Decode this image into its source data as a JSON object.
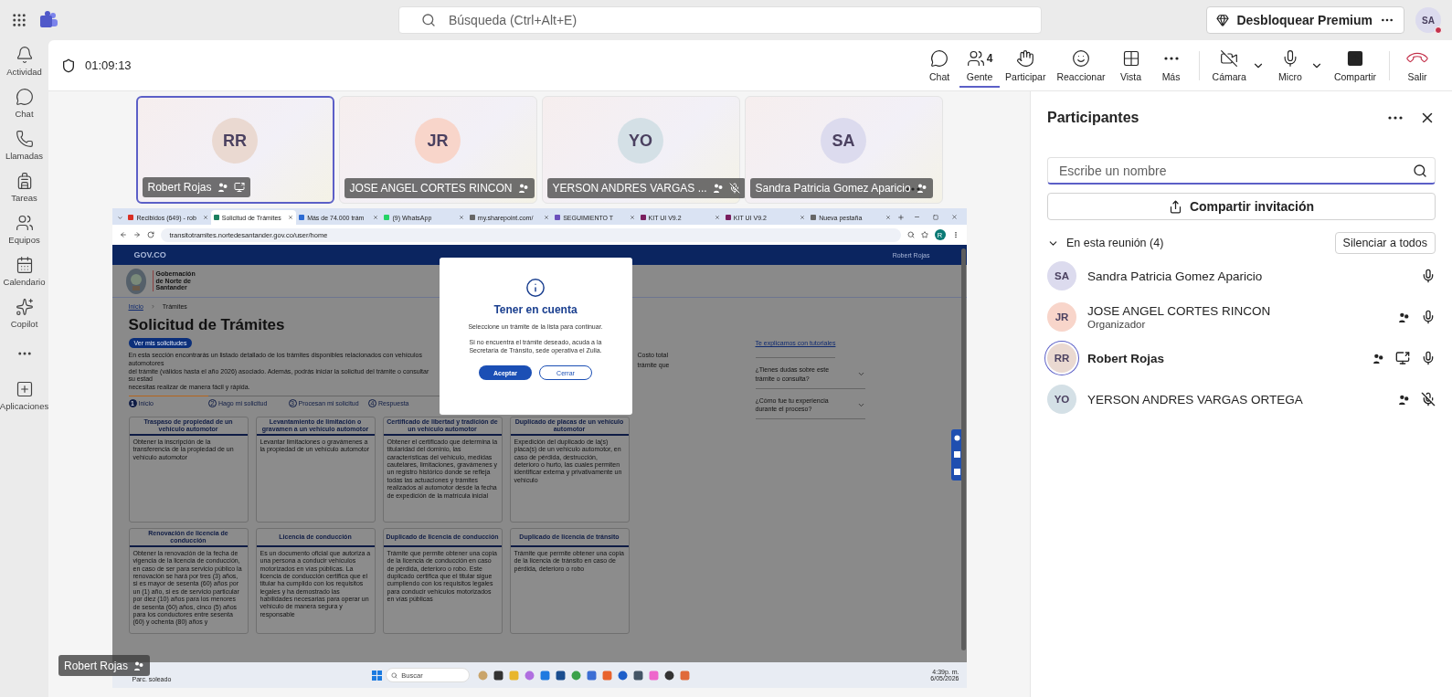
{
  "top_bar": {
    "search": {
      "placeholder": "Búsqueda (Ctrl+Alt+E)"
    },
    "premium_button": "Desbloquear Premium",
    "avatar": "SA"
  },
  "rail": {
    "items": [
      {
        "label": "Actividad"
      },
      {
        "label": "Chat"
      },
      {
        "label": "Llamadas"
      },
      {
        "label": "Tareas"
      },
      {
        "label": "Equipos"
      },
      {
        "label": "Calendario"
      },
      {
        "label": "Copilot"
      },
      {
        "label": "Aplicaciones"
      }
    ]
  },
  "meeting_bar": {
    "timer": "01:09:13",
    "actions": [
      {
        "label": "Chat",
        "kind": "normal",
        "selected": false
      },
      {
        "label": "Gente",
        "kind": "normal",
        "selected": true,
        "badge": "4"
      },
      {
        "label": "Participar",
        "kind": "normal",
        "selected": false
      },
      {
        "label": "Reaccionar",
        "kind": "normal",
        "selected": false
      },
      {
        "label": "Vista",
        "kind": "normal",
        "selected": false
      },
      {
        "label": "Más",
        "kind": "normal",
        "selected": false
      },
      {
        "label": "Cámara",
        "kind": "split",
        "selected": false
      },
      {
        "label": "Micro",
        "kind": "split",
        "selected": false
      },
      {
        "label": "Compartir",
        "kind": "normal",
        "selected": false
      },
      {
        "label": "Salir",
        "kind": "leave",
        "selected": false
      }
    ]
  },
  "tiles": [
    {
      "initials": "RR",
      "name": "Robert Rojas",
      "selected": true,
      "color": "#ead9d1",
      "muted": false,
      "sharing": true,
      "menu": false
    },
    {
      "initials": "JR",
      "name": "JOSE ANGEL CORTES RINCON",
      "selected": false,
      "color": "#f8d5ca",
      "muted": false,
      "sharing": false,
      "menu": false
    },
    {
      "initials": "YO",
      "name": "YERSON ANDRES VARGAS ...",
      "selected": false,
      "color": "#d4e0e6",
      "muted": true,
      "sharing": false,
      "menu": false
    },
    {
      "initials": "SA",
      "name": "Sandra Patricia Gomez Aparicio",
      "selected": false,
      "color": "#dcdbee",
      "muted": false,
      "sharing": false,
      "menu": true
    }
  ],
  "shared_screen": {
    "browser_tabs": [
      {
        "title": "Recibidos (649) - rob",
        "selected": false
      },
      {
        "title": "Solicitud de Trámites",
        "selected": true
      },
      {
        "title": "Más de 74.000 trám",
        "selected": false
      },
      {
        "title": "(9) WhatsApp",
        "selected": false
      },
      {
        "title": "my.sharepoint.com/",
        "selected": false
      },
      {
        "title": "SEGUIMIENTO T",
        "selected": false
      },
      {
        "title": "KIT UI V9.2",
        "selected": false
      },
      {
        "title": "KIT UI V9.2",
        "selected": false
      },
      {
        "title": "Nueva pestaña",
        "selected": false
      }
    ],
    "url": "transitotramites.nortedesantander.gov.co/user/home",
    "profile": "R",
    "site_logo": "GOV.CO",
    "user_menu": "Robert Rojas",
    "org_name": "Gobernación de Norte de Santander",
    "breadcrumb": [
      "Inicio",
      "Trámites"
    ],
    "heading": "Solicitud de Trámites",
    "my_requests_button": "Ver mis solicitudes",
    "intro_left": [
      "En esta sección encontrarás un listado detallado de los trámites disponibles relacionados con vehículos automotores",
      "del trámite (válidos hasta el año 2026) asociado. Además, podrás iniciar la solicitud del trámite o consultar su estad",
      "necesitas realizar de manera fácil y rápida."
    ],
    "intro_right": [
      "Costo total",
      "trámite que"
    ],
    "steps": [
      {
        "number": "1",
        "label": "Inicio",
        "selected": true
      },
      {
        "number": "2",
        "label": "Hago mi solicitud",
        "selected": false
      },
      {
        "number": "3",
        "label": "Procesan mi solicitud",
        "selected": false
      },
      {
        "number": "4",
        "label": "Respuesta",
        "selected": false
      }
    ],
    "cards": [
      {
        "title": "Traspaso de propiedad de un vehículo automotor",
        "body": "Obtener la inscripción de la transferencia de la propiedad de un vehículo automotor"
      },
      {
        "title": "Levantamiento de limitación o gravamen a un vehículo automotor",
        "body": "Levantar limitaciones o gravámenes a la propiedad de un vehículo automotor"
      },
      {
        "title": "Certificado de libertad y tradición de un vehículo automotor",
        "body": "Obtener el certificado que determina la titularidad del dominio, las características del vehículo, medidas cautelares, limitaciones, gravámenes y un registro histórico donde se refleja todas las actuaciones y trámites realizados al automotor desde la fecha de expedición de la matrícula inicial"
      },
      {
        "title": "Duplicado de placas de un vehículo automotor",
        "body": "Expedición del duplicado de la(s) placa(s) de un vehículo automotor, en caso de pérdida, destrucción, deterioro o hurto, las cuales permiten identificar externa y privativamente un vehículo"
      },
      {
        "title": "Renovación de licencia de conducción",
        "body": "Obtener la renovación de la fecha de vigencia de la licencia de conducción, en caso de ser para servicio público la renovación se hará por tres (3) años, si es mayor de sesenta (60) años por un (1) año, si es de servicio particular por diez (10) años para los menores de sesenta (60) años, cinco (5) años para los conductores entre sesenta (60) y ochenta (80) años y"
      },
      {
        "title": "Licencia de conducción",
        "body": "Es un documento oficial que autoriza a una persona a conducir vehículos motorizados en vías públicas. La licencia de conducción certifica que el titular ha cumplido con los requisitos legales y ha demostrado las habilidades necesarias para operar un vehículo de manera segura y responsable"
      },
      {
        "title": "Duplicado de licencia de conducción",
        "body": "Trámite que permite obtener una copia de la licencia de conducción en caso de pérdida, deterioro o robo. Este duplicado certifica que el titular sigue cumpliendo con los requisitos legales para conducir vehículos motorizados en vías públicas"
      },
      {
        "title": "Duplicado de licencia de tránsito",
        "body": "Trámite que permite obtener una copia de la licencia de tránsito en caso de pérdida, deterioro o robo"
      }
    ],
    "tutorials_link": "Te explicamos con tutoriales",
    "faq": [
      {
        "question": "¿Tienes dudas sobre este trámite o consulta?"
      },
      {
        "question": "¿Cómo fue tu experiencia durante el proceso?"
      }
    ],
    "modal": {
      "title": "Tener en cuenta",
      "messages": [
        "Seleccione un trámite de la lista para continuar.",
        "Si no encuentra el trámite deseado, acuda a la Secretaría de Tránsito, sede operativa el Zulia."
      ],
      "accept": "Aceptar",
      "close": "Cerrar"
    },
    "taskbar": {
      "weather": "Parc. soleado",
      "search": "Buscar",
      "time": "4:39p. m.",
      "date": "6/05/2026"
    },
    "presenter": "Robert Rojas"
  },
  "panel": {
    "title": "Participantes",
    "search": {
      "placeholder": "Escribe un nombre"
    },
    "invite_button": "Compartir invitación",
    "section": {
      "label": "En esta reunión (4)",
      "expanded": true
    },
    "mute_all": "Silenciar a todos",
    "participants": [
      {
        "initials": "SA",
        "name": "Sandra Patricia Gomez Aparicio",
        "color": "#dcdbee",
        "speaking": false,
        "badge": false,
        "sharing": false,
        "muted": false
      },
      {
        "initials": "JR",
        "name": "JOSE ANGEL CORTES RINCON",
        "role": "Organizador",
        "color": "#f8d5ca",
        "speaking": false,
        "badge": true,
        "sharing": false,
        "muted": false
      },
      {
        "initials": "RR",
        "name": "Robert Rojas",
        "color": "#ead9d1",
        "speaking": true,
        "badge": true,
        "sharing": true,
        "muted": false
      },
      {
        "initials": "YO",
        "name": "YERSON ANDRES VARGAS ORTEGA",
        "color": "#d4e0e6",
        "speaking": false,
        "badge": true,
        "sharing": false,
        "muted": true
      }
    ]
  }
}
